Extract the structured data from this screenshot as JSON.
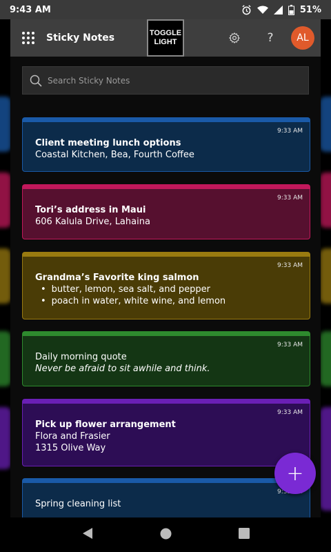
{
  "status_bar": {
    "time": "9:43 AM",
    "battery": "51%",
    "icons": [
      "alarm-icon",
      "wifi-icon",
      "signal-icon",
      "battery-icon"
    ]
  },
  "header": {
    "title": "Sticky Notes",
    "toggle_label": "TOGGLE\nLIGHT",
    "settings_icon": "gear-icon",
    "help_icon": "?",
    "avatar_initials": "AL"
  },
  "search": {
    "placeholder": "Search Sticky Notes"
  },
  "notes": [
    {
      "time": "9:33 AM",
      "title": "Client meeting lunch options",
      "lines": [
        "Coastal Kitchen, Bea, Fourth Coffee"
      ],
      "color": "#1a5aa8",
      "bg": "#0c2b4a"
    },
    {
      "time": "9:33 AM",
      "title": "Tori’s address in Maui",
      "lines": [
        "606 Kalula Drive, Lahaina"
      ],
      "color": "#c2185b",
      "bg": "#56102f"
    },
    {
      "time": "9:33 AM",
      "title": "Grandma’s Favorite king salmon",
      "bullets": [
        "butter, lemon, sea salt, and pepper",
        "poach in water, white wine, and lemon"
      ],
      "color": "#9a7b10",
      "bg": "#4a3c06"
    },
    {
      "time": "9:33 AM",
      "title": "Daily morning quote",
      "italic": "Never be afraid to sit awhile and think.",
      "color": "#2e8b2e",
      "bg": "#143614"
    },
    {
      "time": "9:33 AM",
      "title": "Pick up flower arrangement",
      "lines": [
        "Flora and Frasier",
        "1315 Olive Way"
      ],
      "color": "#6a1fb5",
      "bg": "#2d0d55"
    },
    {
      "time": "9:32 AM",
      "title": "Spring cleaning list",
      "color": "#1a5aa8",
      "bg": "#0c2b4a"
    }
  ],
  "fab": {
    "label": "+"
  },
  "nav": {
    "back_icon": "back-triangle-icon",
    "home_icon": "home-circle-icon",
    "recents_icon": "recents-square-icon"
  }
}
